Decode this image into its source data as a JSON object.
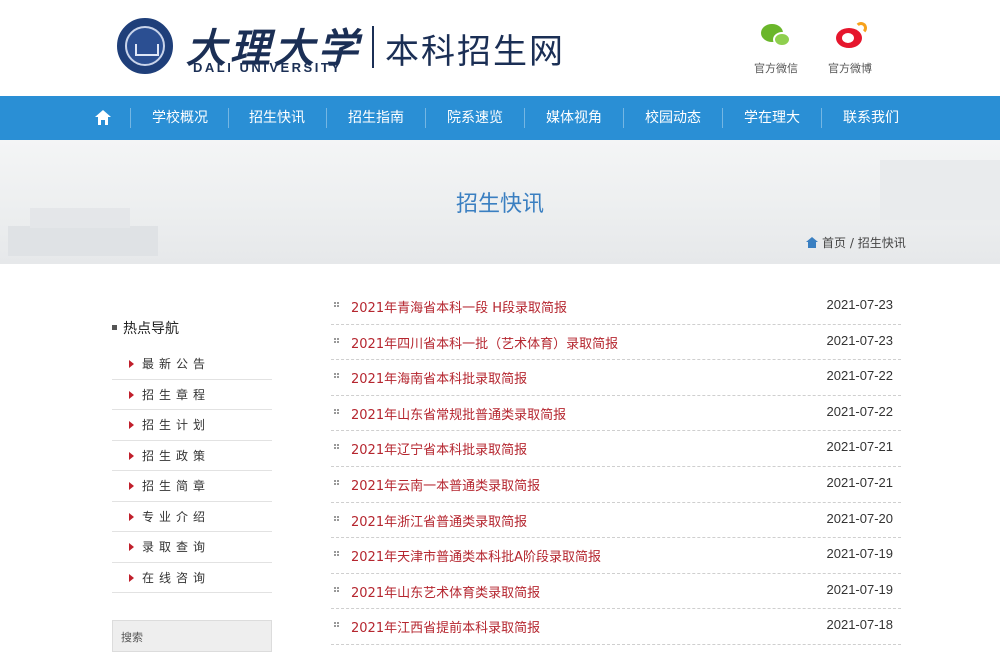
{
  "header": {
    "logo_cn": "大理大学",
    "logo_en": "DALI UNIVERSITY",
    "site_name": "本科招生网",
    "social": [
      {
        "label": "官方微信",
        "icon": "wechat-icon"
      },
      {
        "label": "官方微博",
        "icon": "weibo-icon"
      }
    ]
  },
  "nav": {
    "home_icon": "home-icon",
    "items": [
      "学校概况",
      "招生快讯",
      "招生指南",
      "院系速览",
      "媒体视角",
      "校园动态",
      "学在理大",
      "联系我们"
    ]
  },
  "banner": {
    "title": "招生快讯",
    "breadcrumb": {
      "home": "首页",
      "separator": "/",
      "current": "招生快讯"
    }
  },
  "sidebar": {
    "title": "热点导航",
    "items": [
      "最新公告",
      "招生章程",
      "招生计划",
      "招生政策",
      "招生简章",
      "专业介绍",
      "录取查询",
      "在线咨询"
    ],
    "search_label": "搜索"
  },
  "news": [
    {
      "title": "2021年青海省本科一段 H段录取简报",
      "date": "2021-07-23"
    },
    {
      "title": "2021年四川省本科一批（艺术体育）录取简报",
      "date": "2021-07-23"
    },
    {
      "title": "2021年海南省本科批录取简报",
      "date": "2021-07-22"
    },
    {
      "title": "2021年山东省常规批普通类录取简报",
      "date": "2021-07-22"
    },
    {
      "title": "2021年辽宁省本科批录取简报",
      "date": "2021-07-21"
    },
    {
      "title": "2021年云南一本普通类录取简报",
      "date": "2021-07-21"
    },
    {
      "title": "2021年浙江省普通类录取简报",
      "date": "2021-07-20"
    },
    {
      "title": "2021年天津市普通类本科批A阶段录取简报",
      "date": "2021-07-19"
    },
    {
      "title": "2021年山东艺术体育类录取简报",
      "date": "2021-07-19"
    },
    {
      "title": "2021年江西省提前本科录取简报",
      "date": "2021-07-18"
    }
  ],
  "colors": {
    "nav_bg": "#2a8fd5",
    "brand_navy": "#1b2f55",
    "news_link": "#b5262f",
    "banner_title": "#3a7fc1"
  }
}
